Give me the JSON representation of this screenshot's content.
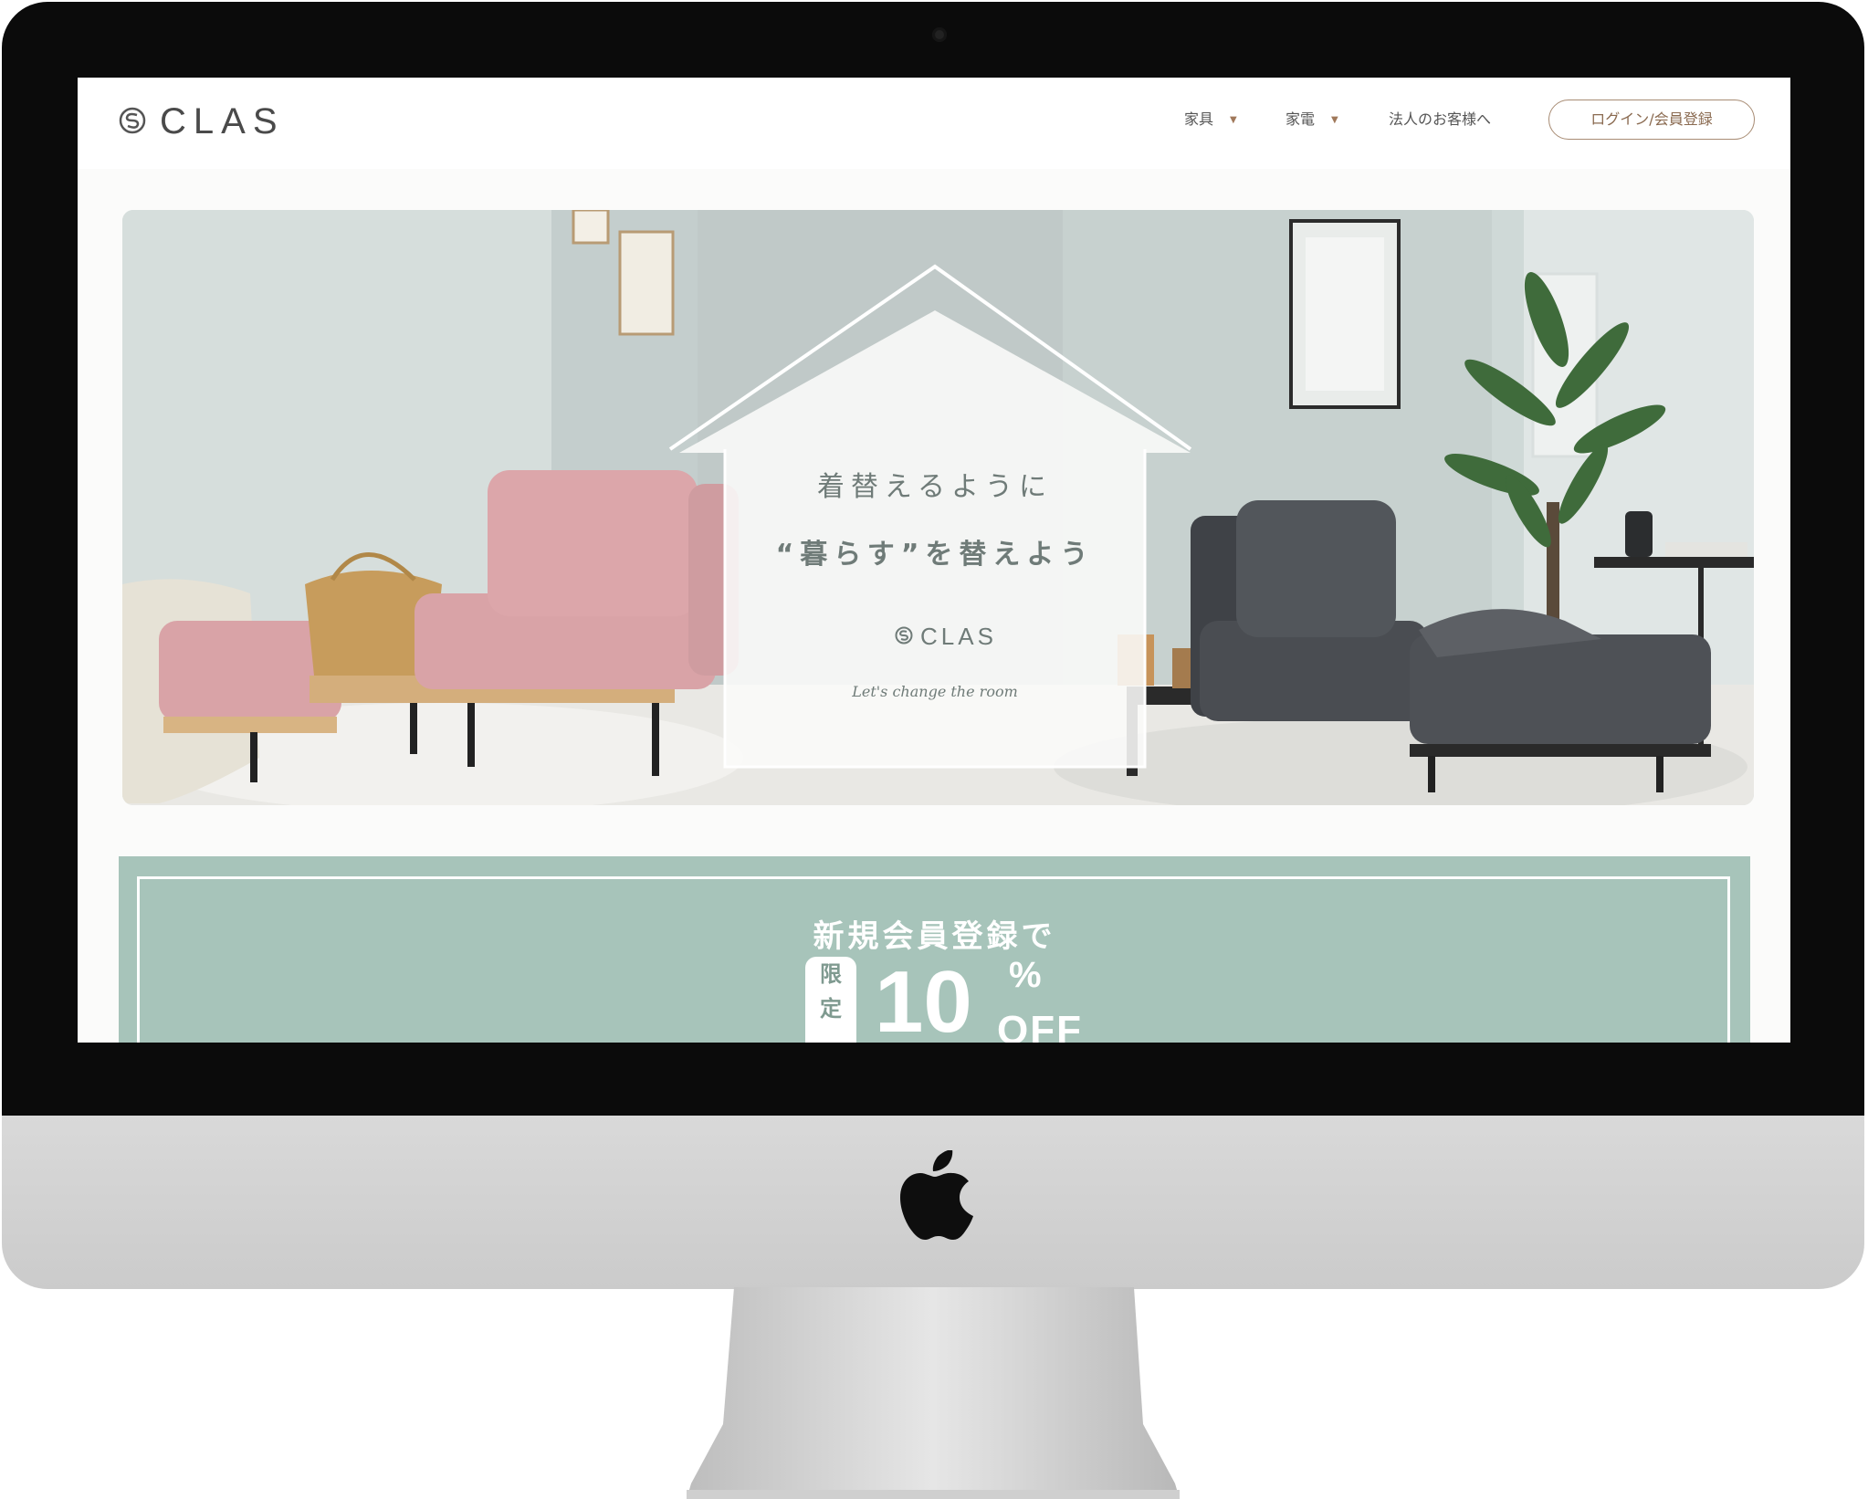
{
  "site": {
    "logo_text": "CLAS"
  },
  "nav": {
    "items": [
      {
        "label": "家具",
        "has_dropdown": true
      },
      {
        "label": "家電",
        "has_dropdown": true
      },
      {
        "label": "法人のお客様へ",
        "has_dropdown": false
      }
    ],
    "login_label": "ログイン/会員登録"
  },
  "hero": {
    "line1": "着替えるように",
    "line2": "“暮らす”を替えよう",
    "logo_text": "CLAS",
    "tagline": "Let's change the room"
  },
  "promo": {
    "title": "新規会員登録で",
    "badge_chars": [
      "限",
      "定"
    ],
    "discount_number": "10",
    "percent_sign": "%",
    "off_text": "OFF"
  },
  "colors": {
    "promo_bg": "#a7c4ba",
    "accent_brown": "#a88c74",
    "pink_sofa": "#d9a3a7",
    "gray_sofa": "#4a4d52"
  },
  "icons": {
    "caret": "caret-down-icon",
    "apple": "apple-logo-icon"
  }
}
